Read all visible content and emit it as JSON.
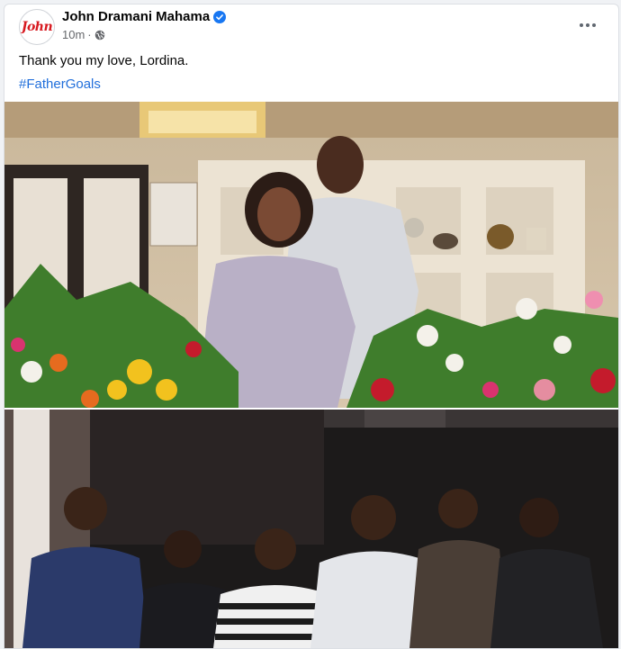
{
  "post": {
    "author": "John Dramani Mahama",
    "avatar_text": "John",
    "time": "10m",
    "separator": "·",
    "text": "Thank you my love, Lordina.",
    "hashtag": "#FatherGoals"
  },
  "icons": {
    "verified": "verified-badge-icon",
    "privacy": "globe-icon",
    "more": "more-options-icon"
  },
  "colors": {
    "link": "#216fdb",
    "verified": "#1877f2",
    "brand_red": "#d71920"
  }
}
